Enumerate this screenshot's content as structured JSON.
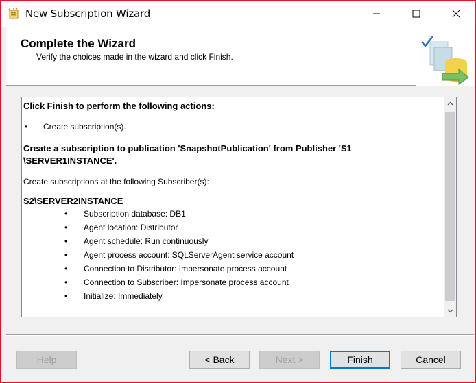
{
  "window": {
    "title": "New Subscription Wizard",
    "minimize_glyph": "—",
    "maximize_glyph": "☐",
    "close_glyph": "✕"
  },
  "header": {
    "title": "Complete the Wizard",
    "subtitle": "Verify the choices made in the wizard and click Finish."
  },
  "content": {
    "intro": "Click Finish to perform the following actions:",
    "action_bullet": "•",
    "actions": [
      "Create subscription(s)."
    ],
    "publication_heading": "Create a subscription to publication 'SnapshotPublication' from Publisher 'S1 \\SERVER1INSTANCE'.",
    "subscribers_intro": "Create subscriptions at the following Subscriber(s):",
    "subscriber_name": "S2\\SERVER2INSTANCE",
    "subscriber_details": [
      "Subscription database: DB1",
      "Agent location: Distributor",
      "Agent schedule: Run continuously",
      "Agent process account: SQLServerAgent service account",
      "Connection to Distributor: Impersonate process account",
      "Connection to Subscriber: Impersonate process account",
      "Initialize: Immediately"
    ]
  },
  "buttons": {
    "help": "Help",
    "back": "< Back",
    "next": "Next >",
    "finish": "Finish",
    "cancel": "Cancel"
  },
  "colors": {
    "window_border": "#e81123",
    "default_button_border": "#0078d7",
    "dialog_background": "#f0f0f0"
  },
  "icons": {
    "app": "wizard-app-icon",
    "header": "database-subscription-icon",
    "scroll_up": "chevron-up-icon",
    "scroll_down": "chevron-down-icon"
  }
}
